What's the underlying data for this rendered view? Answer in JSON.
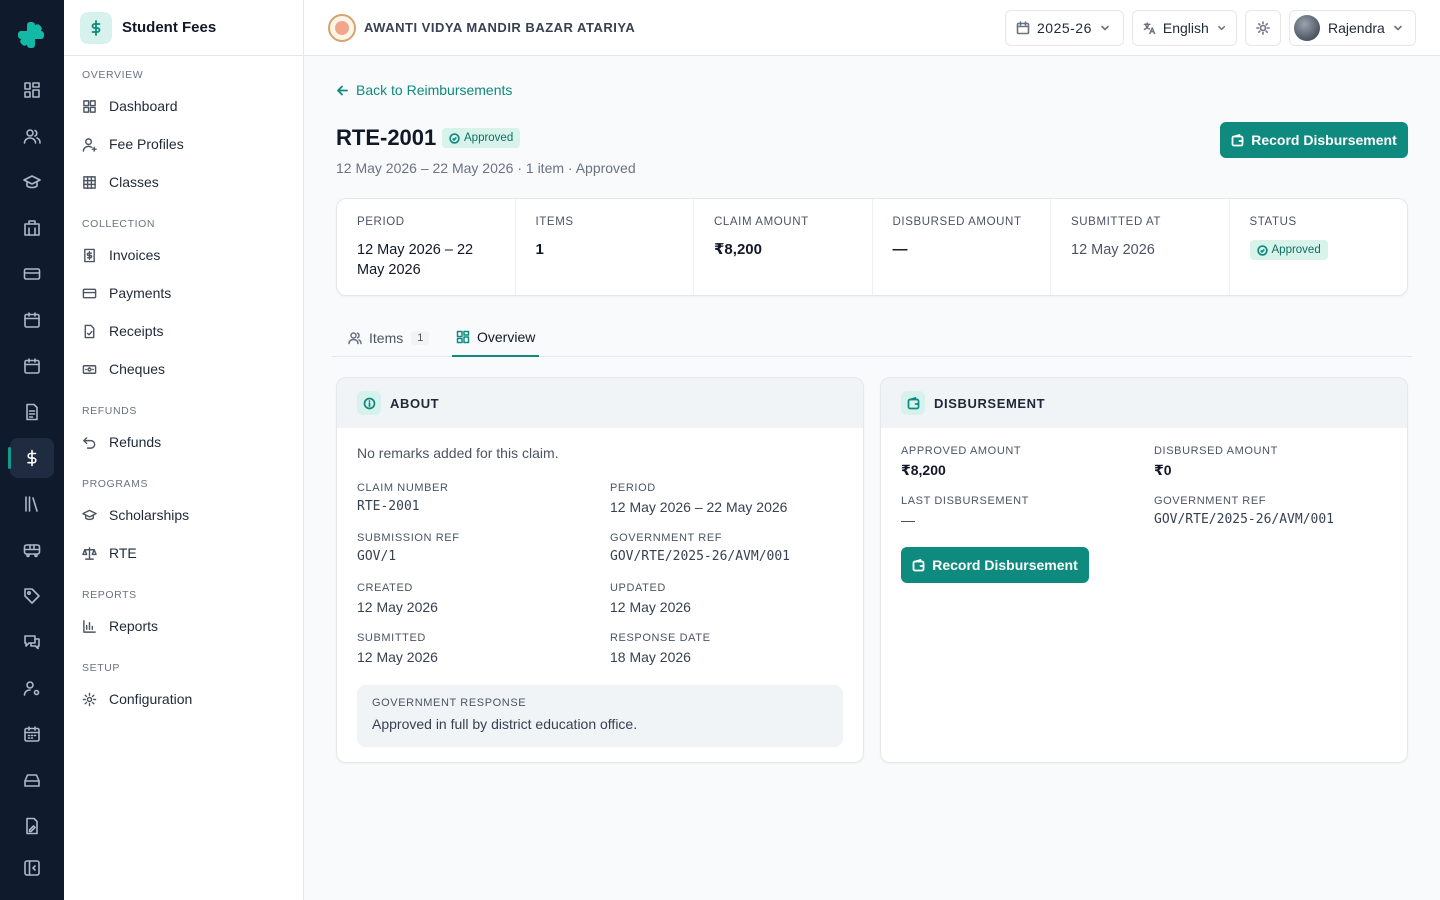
{
  "module": {
    "name": "Student Fees"
  },
  "sidebar": {
    "sections": [
      {
        "title": "OVERVIEW",
        "items": [
          {
            "label": "Dashboard"
          },
          {
            "label": "Fee Profiles"
          },
          {
            "label": "Classes"
          }
        ]
      },
      {
        "title": "COLLECTION",
        "items": [
          {
            "label": "Invoices"
          },
          {
            "label": "Payments"
          },
          {
            "label": "Receipts"
          },
          {
            "label": "Cheques"
          }
        ]
      },
      {
        "title": "REFUNDS",
        "items": [
          {
            "label": "Refunds"
          }
        ]
      },
      {
        "title": "PROGRAMS",
        "items": [
          {
            "label": "Scholarships"
          },
          {
            "label": "RTE"
          }
        ]
      },
      {
        "title": "REPORTS",
        "items": [
          {
            "label": "Reports"
          }
        ]
      },
      {
        "title": "SETUP",
        "items": [
          {
            "label": "Configuration"
          }
        ]
      }
    ]
  },
  "topbar": {
    "school_name": "AWANTI VIDYA MANDIR BAZAR ATARIYA",
    "year": "2025-26",
    "language": "English",
    "user": "Rajendra"
  },
  "page": {
    "back_label": "Back to Reimbursements",
    "title": "RTE-2001",
    "status": "Approved",
    "subtitle": "12 May 2026 – 22 May 2026 · 1 item · Approved",
    "record_button": "Record Disbursement"
  },
  "stats": {
    "period_label": "PERIOD",
    "period_value": "12 May 2026 – 22 May 2026",
    "items_label": "ITEMS",
    "items_value": "1",
    "claim_label": "CLAIM AMOUNT",
    "claim_value": "₹8,200",
    "disbursed_label": "DISBURSED AMOUNT",
    "disbursed_value": "—",
    "submitted_label": "SUBMITTED AT",
    "submitted_value": "12 May 2026",
    "status_label": "STATUS",
    "status_value": "Approved"
  },
  "tabs": {
    "items_label": "Items",
    "items_count": "1",
    "overview_label": "Overview"
  },
  "about": {
    "title": "ABOUT",
    "remarks": "No remarks added for this claim.",
    "claim_number_label": "CLAIM NUMBER",
    "claim_number": "RTE-2001",
    "period_label": "PERIOD",
    "period": "12 May 2026 – 22 May 2026",
    "submission_ref_label": "SUBMISSION REF",
    "submission_ref": "GOV/1",
    "government_ref_label": "GOVERNMENT REF",
    "government_ref": "GOV/RTE/2025-26/AVM/001",
    "created_label": "CREATED",
    "created": "12 May 2026",
    "updated_label": "UPDATED",
    "updated": "12 May 2026",
    "submitted_label": "SUBMITTED",
    "submitted": "12 May 2026",
    "response_date_label": "RESPONSE DATE",
    "response_date": "18 May 2026",
    "gov_response_label": "GOVERNMENT RESPONSE",
    "gov_response": "Approved in full by district education office."
  },
  "disbursement": {
    "title": "DISBURSEMENT",
    "approved_label": "APPROVED AMOUNT",
    "approved": "₹8,200",
    "disbursed_label": "DISBURSED AMOUNT",
    "disbursed": "₹0",
    "last_label": "LAST DISBURSEMENT",
    "last": "—",
    "gov_ref_label": "GOVERNMENT REF",
    "gov_ref": "GOV/RTE/2025-26/AVM/001",
    "button": "Record Disbursement"
  },
  "colors": {
    "brand": "#0f8a7e",
    "rail": "#0f1b2d",
    "badge_bg": "#d8f3ea"
  }
}
